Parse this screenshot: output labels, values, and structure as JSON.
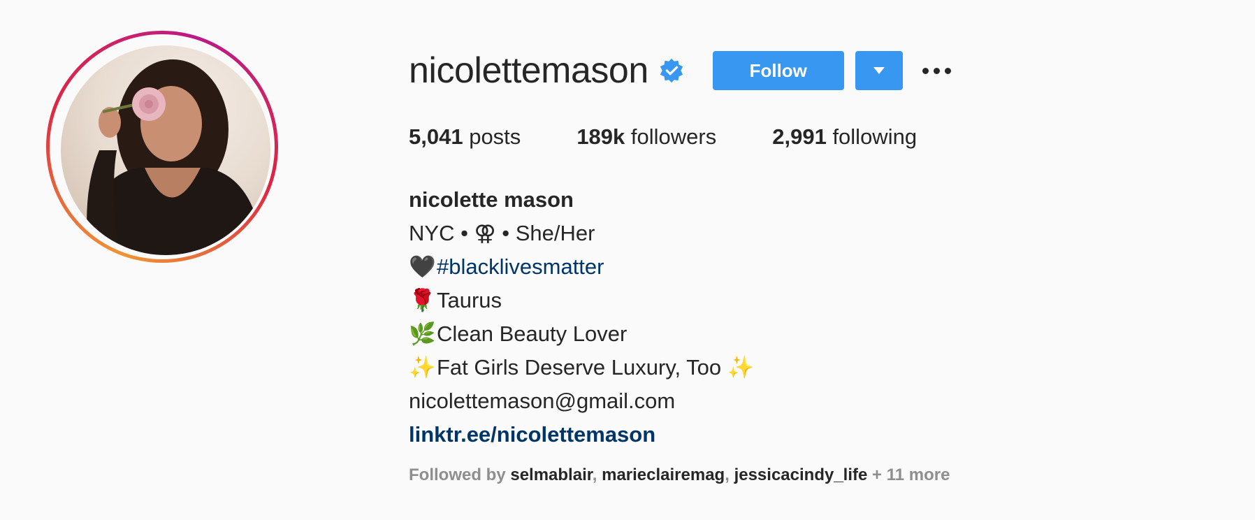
{
  "profile": {
    "username": "nicolettemason",
    "verified": true,
    "accent_color": "#3897f0",
    "link_color": "#003569"
  },
  "actions": {
    "follow_label": "Follow",
    "dropdown_icon": "caret-down-icon",
    "more_icon": "more-options-icon"
  },
  "stats": {
    "posts_count": "5,041",
    "posts_label": "posts",
    "followers_count": "189k",
    "followers_label": "followers",
    "following_count": "2,991",
    "following_label": "following"
  },
  "bio": {
    "full_name": "nicolette mason",
    "line1": "NYC • ⚢ • She/Her",
    "line2_emoji": "🖤",
    "line2_hashtag": "#blacklivesmatter",
    "line3_emoji": "🌹",
    "line3_text": "Taurus",
    "line4_emoji": "🌿",
    "line4_text": "Clean Beauty Lover",
    "line5_emoji_start": "✨",
    "line5_text": "Fat Girls Deserve Luxury, Too",
    "line5_emoji_end": "✨",
    "email": "nicolettemason@gmail.com",
    "website": "linktr.ee/nicolettemason"
  },
  "followed_by": {
    "prefix": "Followed by",
    "accounts": [
      "selmablair",
      "marieclairemag",
      "jessicacindy_life"
    ],
    "separator": ",",
    "more": "+ 11 more"
  }
}
